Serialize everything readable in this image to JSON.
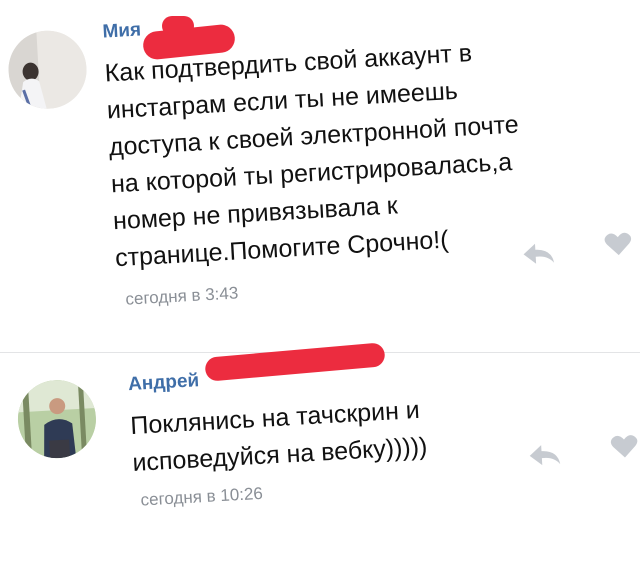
{
  "comments": [
    {
      "author": "Мия",
      "text": "Как подтвердить свой аккаунт в\nинстаграм если ты не имеешь\nдоступа к своей электронной почте\nна которой ты регистрировалась,а\nномер не привязывала к\nстранице.Помогите Срочно!(",
      "time": "сегодня в 3:43",
      "avatar_icon": "photo-avatar-person-light",
      "reply_icon": "reply-arrow-icon",
      "like_icon": "heart-icon"
    },
    {
      "author": "Андрей",
      "text": "Поклянись  на тачскрин и\nисповедуйся на вебку)))))",
      "time": "сегодня в 10:26",
      "avatar_icon": "photo-avatar-person-forest",
      "reply_icon": "reply-arrow-icon",
      "like_icon": "heart-icon"
    }
  ],
  "colors": {
    "author": "#3f6ea8",
    "text": "#111111",
    "time": "#8a8f96",
    "icons": "#c7cbd1",
    "redaction": "#ec2c3f"
  }
}
